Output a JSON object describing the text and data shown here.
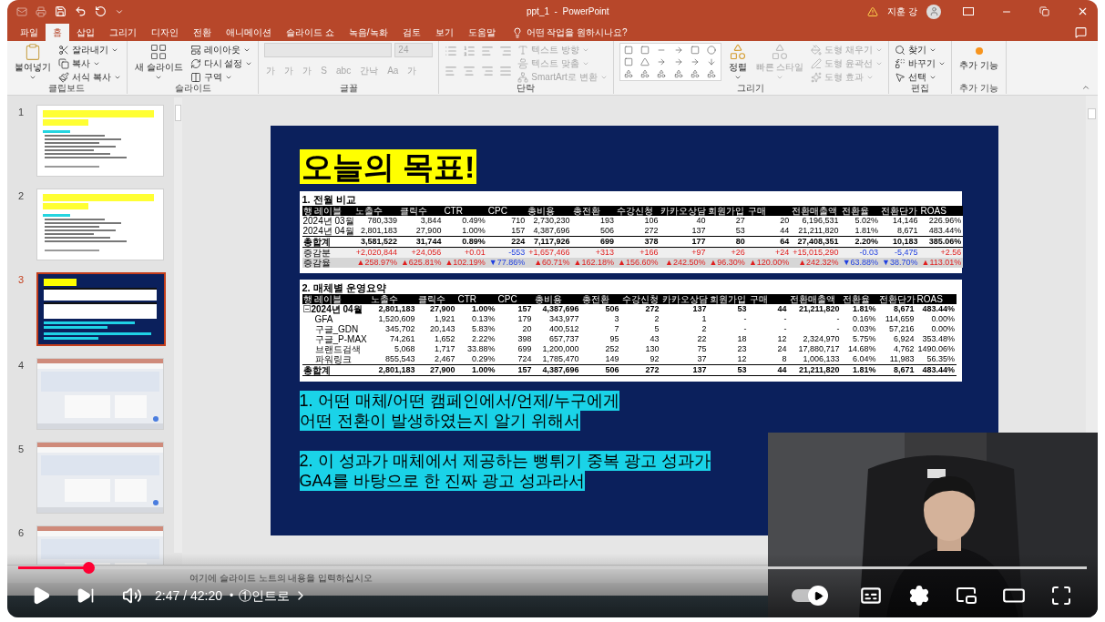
{
  "window": {
    "title": "ppt_1  -  PowerPoint",
    "user": "지훈 강"
  },
  "ribbon_tabs": [
    {
      "label": "파일",
      "selected": false
    },
    {
      "label": "홈",
      "selected": true
    },
    {
      "label": "삽입",
      "selected": false
    },
    {
      "label": "그리기",
      "selected": false
    },
    {
      "label": "디자인",
      "selected": false
    },
    {
      "label": "전환",
      "selected": false
    },
    {
      "label": "애니메이션",
      "selected": false
    },
    {
      "label": "슬라이드 쇼",
      "selected": false
    },
    {
      "label": "녹음/녹화",
      "selected": false
    },
    {
      "label": "검토",
      "selected": false
    },
    {
      "label": "보기",
      "selected": false
    },
    {
      "label": "도움말",
      "selected": false
    }
  ],
  "tell_me": "어떤 작업을 원하시나요?",
  "ribbon_groups": [
    {
      "label": "클립보드",
      "items": [
        {
          "kind": "large",
          "label": "붙여넣기",
          "disabled": false
        },
        {
          "kind": "small",
          "label": "잘라내기",
          "disabled": false
        },
        {
          "kind": "small",
          "label": "복사",
          "disabled": false
        },
        {
          "kind": "small",
          "label": "서식 복사",
          "disabled": false
        }
      ]
    },
    {
      "label": "슬라이드",
      "items": [
        {
          "kind": "large",
          "label": "새 슬라이드",
          "disabled": false
        },
        {
          "kind": "small",
          "label": "레이아웃",
          "disabled": false
        },
        {
          "kind": "small",
          "label": "다시 설정",
          "disabled": false
        },
        {
          "kind": "small",
          "label": "구역",
          "disabled": false
        }
      ]
    },
    {
      "label": "글꼴",
      "items": [
        {
          "kind": "font",
          "label": "24",
          "disabled": true
        },
        {
          "kind": "glyph",
          "label": "가",
          "disabled": true
        },
        {
          "kind": "glyph",
          "label": "가",
          "disabled": true
        },
        {
          "kind": "glyph",
          "label": "가",
          "disabled": true
        },
        {
          "kind": "glyph",
          "label": "S",
          "disabled": true
        },
        {
          "kind": "glyph",
          "label": "abc",
          "disabled": true
        },
        {
          "kind": "glyph",
          "label": "간낙",
          "disabled": true
        },
        {
          "kind": "glyph",
          "label": "Aa",
          "disabled": true
        },
        {
          "kind": "glyph",
          "label": "가",
          "disabled": true
        }
      ]
    },
    {
      "label": "단락",
      "items": [
        {
          "kind": "small",
          "label": "텍스트 방향",
          "disabled": true
        },
        {
          "kind": "small",
          "label": "텍스트 맞춤",
          "disabled": true
        },
        {
          "kind": "small",
          "label": "SmartArt로 변환",
          "disabled": true
        }
      ]
    },
    {
      "label": "그리기",
      "items": [
        {
          "kind": "gallery",
          "label": "정렬",
          "disabled": false
        },
        {
          "kind": "large",
          "label": "빠른 스타일",
          "disabled": true
        },
        {
          "kind": "small",
          "label": "도형 채우기",
          "disabled": true
        },
        {
          "kind": "small",
          "label": "도형 윤곽선",
          "disabled": true
        },
        {
          "kind": "small",
          "label": "도형 효과",
          "disabled": true
        }
      ]
    },
    {
      "label": "편집",
      "items": [
        {
          "kind": "small",
          "label": "찾기",
          "disabled": false
        },
        {
          "kind": "small",
          "label": "바꾸기",
          "disabled": false
        },
        {
          "kind": "small",
          "label": "선택",
          "disabled": false
        }
      ]
    },
    {
      "label": "추가 기능",
      "items": [
        {
          "kind": "large",
          "label": "추가 기능",
          "disabled": false
        }
      ]
    }
  ],
  "slides": [
    {
      "number": "1",
      "selected": false,
      "kind": "text"
    },
    {
      "number": "2",
      "selected": false,
      "kind": "text"
    },
    {
      "number": "3",
      "selected": true,
      "kind": "current"
    },
    {
      "number": "4",
      "selected": false,
      "kind": "screenshot"
    },
    {
      "number": "5",
      "selected": false,
      "kind": "screenshot"
    },
    {
      "number": "6",
      "selected": false,
      "kind": "screenshot"
    }
  ],
  "slide": {
    "title": "오늘의 목표!",
    "tables": [
      {
        "title": "1. 전월 비교",
        "columns": [
          "행 레이블",
          "노출수",
          "클릭수",
          "CTR",
          "CPC",
          "총비용",
          "총전환",
          "수강신청",
          "카카오상담",
          "회원가입",
          "구매",
          "전환매출액",
          "전환율",
          "전환단가",
          "ROAS"
        ],
        "rows": [
          {
            "kind": "data",
            "cells": [
              "2024년 03월",
              "780,339",
              "3,844",
              "0.49%",
              "710",
              "2,730,230",
              "193",
              "106",
              "40",
              "27",
              "20",
              "6,196,531",
              "5.02%",
              "14,146",
              "226.96%"
            ]
          },
          {
            "kind": "data",
            "cells": [
              "2024년 04월",
              "2,801,183",
              "27,900",
              "1.00%",
              "157",
              "4,387,696",
              "506",
              "272",
              "137",
              "53",
              "44",
              "21,211,820",
              "1.81%",
              "8,671",
              "483.44%"
            ]
          },
          {
            "kind": "total",
            "cells": [
              "총합계",
              "3,581,522",
              "31,744",
              "0.89%",
              "224",
              "7,117,926",
              "699",
              "378",
              "177",
              "80",
              "64",
              "27,408,351",
              "2.20%",
              "10,183",
              "385.06%"
            ]
          },
          {
            "kind": "change",
            "cells": [
              "증감분",
              {
                "text": "+2,020,844",
                "kind": "up"
              },
              {
                "text": "+24,056",
                "kind": "up"
              },
              {
                "text": "+0.01",
                "kind": "up"
              },
              {
                "text": "-553",
                "kind": "down"
              },
              {
                "text": "+1,657,466",
                "kind": "up"
              },
              {
                "text": "+313",
                "kind": "up"
              },
              {
                "text": "+166",
                "kind": "up"
              },
              {
                "text": "+97",
                "kind": "up"
              },
              {
                "text": "+26",
                "kind": "up"
              },
              {
                "text": "+24",
                "kind": "up"
              },
              {
                "text": "+15,015,290",
                "kind": "up"
              },
              {
                "text": "-0.03",
                "kind": "down"
              },
              {
                "text": "-5,475",
                "kind": "down"
              },
              {
                "text": "+2.56",
                "kind": "up"
              }
            ]
          },
          {
            "kind": "rate",
            "cells": [
              "증감율",
              {
                "text": "▲258.97%",
                "kind": "up"
              },
              {
                "text": "▲625.81%",
                "kind": "up"
              },
              {
                "text": "▲102.19%",
                "kind": "up"
              },
              {
                "text": "▼77.86%",
                "kind": "down"
              },
              {
                "text": "▲60.71%",
                "kind": "up"
              },
              {
                "text": "▲162.18%",
                "kind": "up"
              },
              {
                "text": "▲156.60%",
                "kind": "up"
              },
              {
                "text": "▲242.50%",
                "kind": "up"
              },
              {
                "text": "▲96.30%",
                "kind": "up"
              },
              {
                "text": "▲120.00%",
                "kind": "up"
              },
              {
                "text": "▲242.32%",
                "kind": "up"
              },
              {
                "text": "▼63.88%",
                "kind": "down"
              },
              {
                "text": "▼38.70%",
                "kind": "down"
              },
              {
                "text": "▲113.01%",
                "kind": "up"
              }
            ]
          }
        ]
      },
      {
        "title": "2. 매체별 운영요약",
        "columns": [
          "행 레이블",
          "노출수",
          "클릭수",
          "CTR",
          "CPC",
          "총비용",
          "총전환",
          "수강신청",
          "카카오상담",
          "회원가입",
          "구매",
          "전환매출액",
          "전환율",
          "전환단가",
          "ROAS"
        ],
        "rows": [
          {
            "kind": "group",
            "expanded": true,
            "cells": [
              "2024년 04월",
              "2,801,183",
              "27,900",
              "1.00%",
              "157",
              "4,387,696",
              "506",
              "272",
              "137",
              "53",
              "44",
              "21,211,820",
              "1.81%",
              "8,671",
              "483.44%"
            ],
            "children": [
              {
                "kind": "data",
                "cells": [
                  "GFA",
                  "1,520,609",
                  "1,921",
                  "0.13%",
                  "179",
                  "343,977",
                  "3",
                  "2",
                  "1",
                  "-",
                  "-",
                  "-",
                  "0.16%",
                  "114,659",
                  "0.00%"
                ]
              },
              {
                "kind": "data",
                "cells": [
                  "구글_GDN",
                  "345,702",
                  "20,143",
                  "5.83%",
                  "20",
                  "400,512",
                  "7",
                  "5",
                  "2",
                  "-",
                  "-",
                  "-",
                  "0.03%",
                  "57,216",
                  "0.00%"
                ]
              },
              {
                "kind": "data",
                "cells": [
                  "구글_P-MAX",
                  "74,261",
                  "1,652",
                  "2.22%",
                  "398",
                  "657,737",
                  "95",
                  "43",
                  "22",
                  "18",
                  "12",
                  "2,324,970",
                  "5.75%",
                  "6,924",
                  "353.48%"
                ]
              },
              {
                "kind": "data",
                "cells": [
                  "브랜드검색",
                  "5,068",
                  "1,717",
                  "33.88%",
                  "699",
                  "1,200,000",
                  "252",
                  "130",
                  "75",
                  "23",
                  "24",
                  "17,880,717",
                  "14.68%",
                  "4,762",
                  "1490.06%"
                ]
              },
              {
                "kind": "data",
                "cells": [
                  "파워링크",
                  "855,543",
                  "2,467",
                  "0.29%",
                  "724",
                  "1,785,470",
                  "149",
                  "92",
                  "37",
                  "12",
                  "8",
                  "1,006,133",
                  "6.04%",
                  "11,983",
                  "56.35%"
                ]
              }
            ]
          },
          {
            "kind": "total",
            "cells": [
              "총합계",
              "2,801,183",
              "27,900",
              "1.00%",
              "157",
              "4,387,696",
              "506",
              "272",
              "137",
              "53",
              "44",
              "21,211,820",
              "1.81%",
              "8,671",
              "483.44%"
            ]
          }
        ]
      }
    ],
    "points": [
      [
        "1. 어떤 매체/어떤 캠페인에서/언제/누구에게",
        "어떤 전환이 발생하였는지 알기 위해서"
      ],
      [
        "2. 이 성과가 매체에서 제공하는 뻥튀기 중복 광고 성과가",
        "GA4를 바탕으로 한 진짜 광고 성과라서"
      ]
    ]
  },
  "notes_placeholder": "여기에 슬라이드 노트의 내용을 입력하십시오",
  "player": {
    "level": 0.066,
    "time": "2:47 / 42:20",
    "separator": "•",
    "chapter": "①인트로",
    "autoplay": {
      "on": true
    }
  }
}
